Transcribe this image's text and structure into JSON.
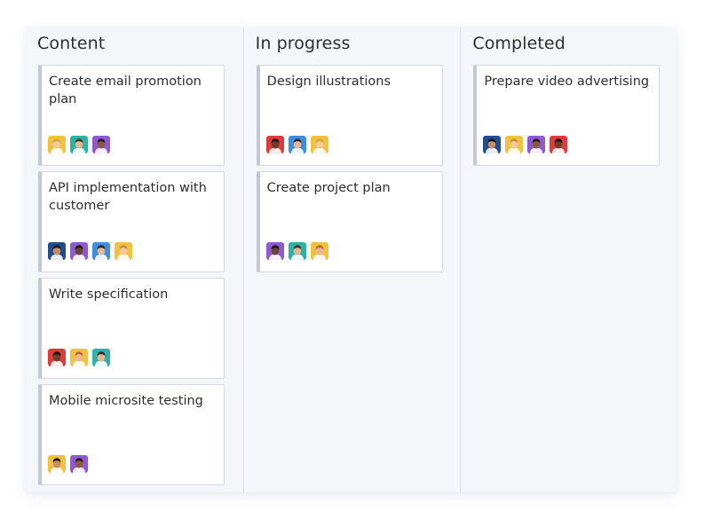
{
  "columns": [
    {
      "title": "Content",
      "cards": [
        {
          "title": "Create email promotion plan",
          "avatars": [
            {
              "bg": "#f3c23c",
              "skin": "#f2c9a0",
              "hair": "#d9a441"
            },
            {
              "bg": "#2bb3a8",
              "skin": "#e8b48f",
              "hair": "#4a3426"
            },
            {
              "bg": "#8e5ad4",
              "skin": "#8a5a3c",
              "hair": "#2a1a12"
            }
          ]
        },
        {
          "title": "API implementation with customer",
          "avatars": [
            {
              "bg": "#1f4e8c",
              "skin": "#c98d66",
              "hair": "#1e1410"
            },
            {
              "bg": "#8e5ad4",
              "skin": "#6b4430",
              "hair": "#1a100c"
            },
            {
              "bg": "#3b8ee0",
              "skin": "#e9b796",
              "hair": "#3a2418"
            },
            {
              "bg": "#f3c23c",
              "skin": "#f2c9a0",
              "hair": "#c98f4a"
            }
          ]
        },
        {
          "title": "Write specification",
          "avatars": [
            {
              "bg": "#e23a3a",
              "skin": "#6b3f2a",
              "hair": "#120a08"
            },
            {
              "bg": "#f3c23c",
              "skin": "#e9b796",
              "hair": "#b86a3c"
            },
            {
              "bg": "#2bb3a8",
              "skin": "#e8b48f",
              "hair": "#3c2a20"
            }
          ]
        },
        {
          "title": "Mobile microsite testing",
          "avatars": [
            {
              "bg": "#f3c23c",
              "skin": "#c98d66",
              "hair": "#1e1410"
            },
            {
              "bg": "#8e5ad4",
              "skin": "#8a5a3c",
              "hair": "#2a1a12"
            }
          ]
        }
      ]
    },
    {
      "title": "In progress",
      "cards": [
        {
          "title": "Design illustrations",
          "avatars": [
            {
              "bg": "#e23a3a",
              "skin": "#6b3f2a",
              "hair": "#120a08"
            },
            {
              "bg": "#3b8ee0",
              "skin": "#e9b796",
              "hair": "#3a2418"
            },
            {
              "bg": "#f3c23c",
              "skin": "#f2c9a0",
              "hair": "#d9a441"
            }
          ]
        },
        {
          "title": "Create project plan",
          "avatars": [
            {
              "bg": "#8e5ad4",
              "skin": "#6b4430",
              "hair": "#1a100c"
            },
            {
              "bg": "#2bb3a8",
              "skin": "#e8b48f",
              "hair": "#4a3426"
            },
            {
              "bg": "#f3c23c",
              "skin": "#e9b796",
              "hair": "#b86a3c"
            }
          ]
        }
      ]
    },
    {
      "title": "Completed",
      "cards": [
        {
          "title": "Prepare video advertising",
          "avatars": [
            {
              "bg": "#1f4e8c",
              "skin": "#c98d66",
              "hair": "#1e1410"
            },
            {
              "bg": "#f3c23c",
              "skin": "#f2c9a0",
              "hair": "#c98f4a"
            },
            {
              "bg": "#8e5ad4",
              "skin": "#8a5a3c",
              "hair": "#2a1a12"
            },
            {
              "bg": "#e23a3a",
              "skin": "#6b3f2a",
              "hair": "#120a08"
            }
          ]
        }
      ]
    }
  ]
}
